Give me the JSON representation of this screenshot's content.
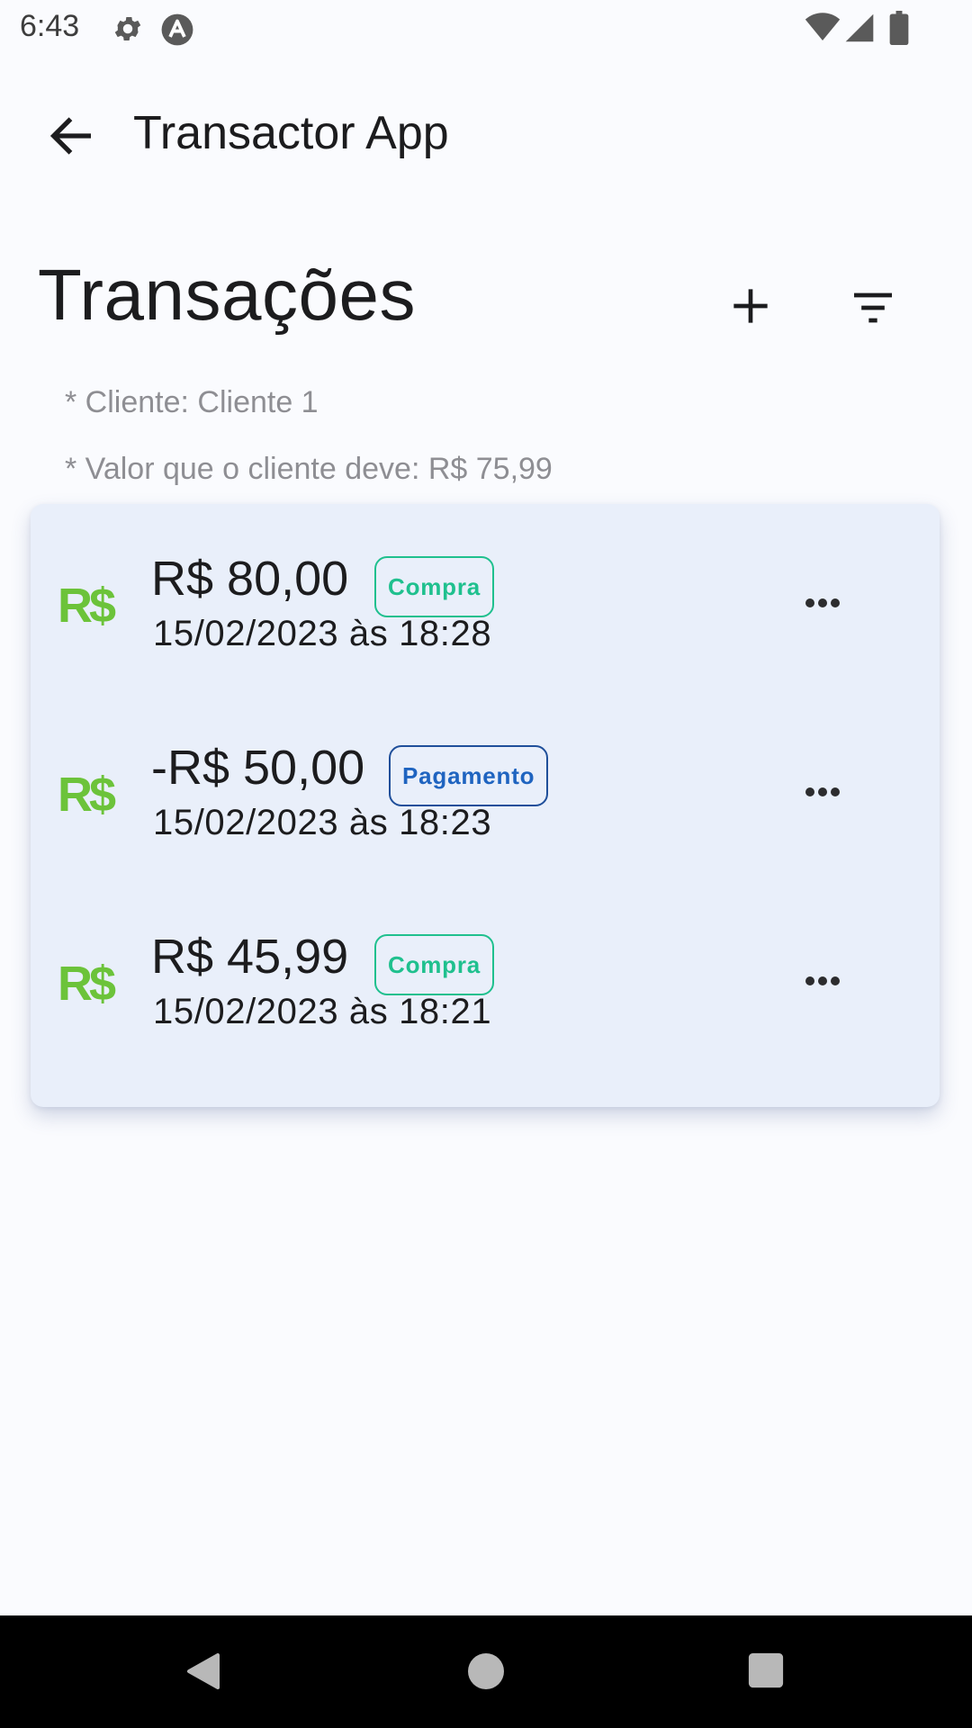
{
  "status_bar": {
    "time": "6:43",
    "icons": [
      "gear-icon",
      "app-icon",
      "wifi-icon",
      "signal-icon",
      "battery-icon"
    ]
  },
  "app_bar": {
    "title": "Transactor App",
    "back_icon": "arrow-left-icon"
  },
  "page": {
    "title": "Transações",
    "add_icon": "plus-icon",
    "filter_icon": "filter-icon",
    "client_line": "* Cliente: Cliente 1",
    "debt_line": "* Valor que o cliente deve: R$ 75,99"
  },
  "transactions": [
    {
      "icon_text": "R$",
      "amount": "R$ 80,00",
      "type": "Compra",
      "date": "15/02/2023 às 18:28"
    },
    {
      "icon_text": "R$",
      "amount": "-R$ 50,00",
      "type": "Pagamento",
      "date": "15/02/2023 às 18:23"
    },
    {
      "icon_text": "R$",
      "amount": "R$ 45,99",
      "type": "Compra",
      "date": "15/02/2023 às 18:21"
    }
  ],
  "colors": {
    "currency_icon": "#6cc33a",
    "badge_compra": "#1fc08e",
    "badge_pagamento": "#1f64c0",
    "card_background": "#e9effa"
  },
  "nav_bar": {
    "icons": [
      "back-triangle-icon",
      "home-circle-icon",
      "recents-square-icon"
    ]
  }
}
